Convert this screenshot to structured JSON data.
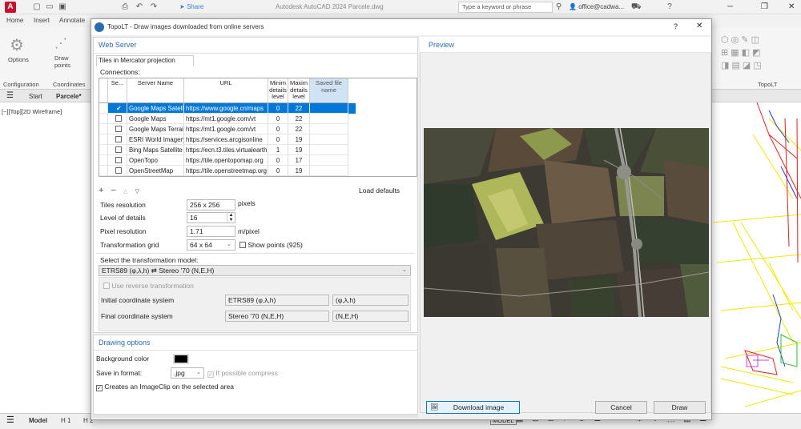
{
  "acad": {
    "title": "Autodesk AutoCAD 2024   Parcele.dwg",
    "share": "Share",
    "search_placeholder": "Type a keyword or phrase",
    "user": "office@cadwa...",
    "ribbon_tabs": [
      "Home",
      "Insert",
      "Annotate"
    ],
    "ribbon": {
      "options_label": "Options",
      "draw_points_label": "Draw\npoints",
      "configuration_label": "Configuration",
      "coordinates_label": "Coordinates",
      "topol_label": "TopoLT"
    },
    "file_tabs": [
      "Start",
      "Parcele*"
    ],
    "viewport_label": "[−][Top][2D Wireframe]",
    "status_tabs": [
      "Model",
      "H 1",
      "H 2"
    ],
    "status_model": "MODEL"
  },
  "dialog": {
    "title": "TopoLT - Draw images downloaded from online servers",
    "help": "?",
    "close": "✕",
    "web_server_title": "Web Server",
    "tiles_tab": "Tiles in Mercator projection",
    "connections_label": "Connections:",
    "columns": [
      "Se...",
      "Server Name",
      "URL",
      "Minim details level",
      "Maxim details level",
      "Saved file name"
    ],
    "rows": [
      {
        "selected": true,
        "name": "Google Maps Satellite",
        "url": "https://www.google.cn/maps",
        "min": "0",
        "max": "22",
        "saved": ""
      },
      {
        "selected": false,
        "name": "Google Maps",
        "url": "https://mt1.google.com/vt",
        "min": "0",
        "max": "22",
        "saved": ""
      },
      {
        "selected": false,
        "name": "Google Maps Terrain",
        "url": "https://mt1.google.com/vt",
        "min": "0",
        "max": "22",
        "saved": ""
      },
      {
        "selected": false,
        "name": "ESRI World Imagery",
        "url": "https://services.arcgisonline",
        "min": "0",
        "max": "19",
        "saved": ""
      },
      {
        "selected": false,
        "name": "Bing Maps Satellite",
        "url": "https://ecn.t3.tiles.virtualearth",
        "min": "1",
        "max": "19",
        "saved": ""
      },
      {
        "selected": false,
        "name": "OpenTopo",
        "url": "https://tile.opentopomap.org",
        "min": "0",
        "max": "17",
        "saved": ""
      },
      {
        "selected": false,
        "name": "OpenStreetMap",
        "url": "https://tile.openstreetmap.org",
        "min": "0",
        "max": "19",
        "saved": ""
      }
    ],
    "grid_tools": [
      "+",
      "−",
      "△",
      "▽"
    ],
    "load_defaults": "Load defaults",
    "tiles_resolution_label": "Tiles resolution",
    "tiles_resolution_value": "256 x 256",
    "tiles_resolution_unit": "pixels",
    "level_label": "Level of details",
    "level_value": "16",
    "pixel_res_label": "Pixel resolution",
    "pixel_res_value": "1.71",
    "pixel_res_unit": "m/pixel",
    "grid_label": "Transformation grid",
    "grid_value": "64 x 64",
    "show_points_label": "Show points (925)",
    "model_label": "Select the transformation model:",
    "model_value": "ETRS89 (φ,λ,h) ⇄ Stereo '70 (N,E,H)",
    "reverse_label": "Use reverse transformation",
    "initial_label": "Initial coordinate system",
    "initial_value": "ETRS89 (φ,λ,h)",
    "initial_axes": "(φ,λ,h)",
    "final_label": "Final coordinate system",
    "final_value": "Stereo '70 (N,E,H)",
    "final_axes": "(N,E,H)",
    "drawing_options_title": "Drawing options",
    "bg_color_label": "Background color",
    "bg_color": "#000000",
    "save_format_label": "Save in format:",
    "save_format_value": ".jpg",
    "compress_label": "If possible compress",
    "imageclip_label": "Creates an ImageClip on the selected area",
    "imageclip_checked": true,
    "preview_title": "Preview",
    "download_button": "Download image",
    "cancel_button": "Cancel",
    "draw_button": "Draw"
  },
  "colors": {
    "accent": "#2b6cb0",
    "selection": "#0078d7",
    "acad_red": "#c8102e"
  }
}
